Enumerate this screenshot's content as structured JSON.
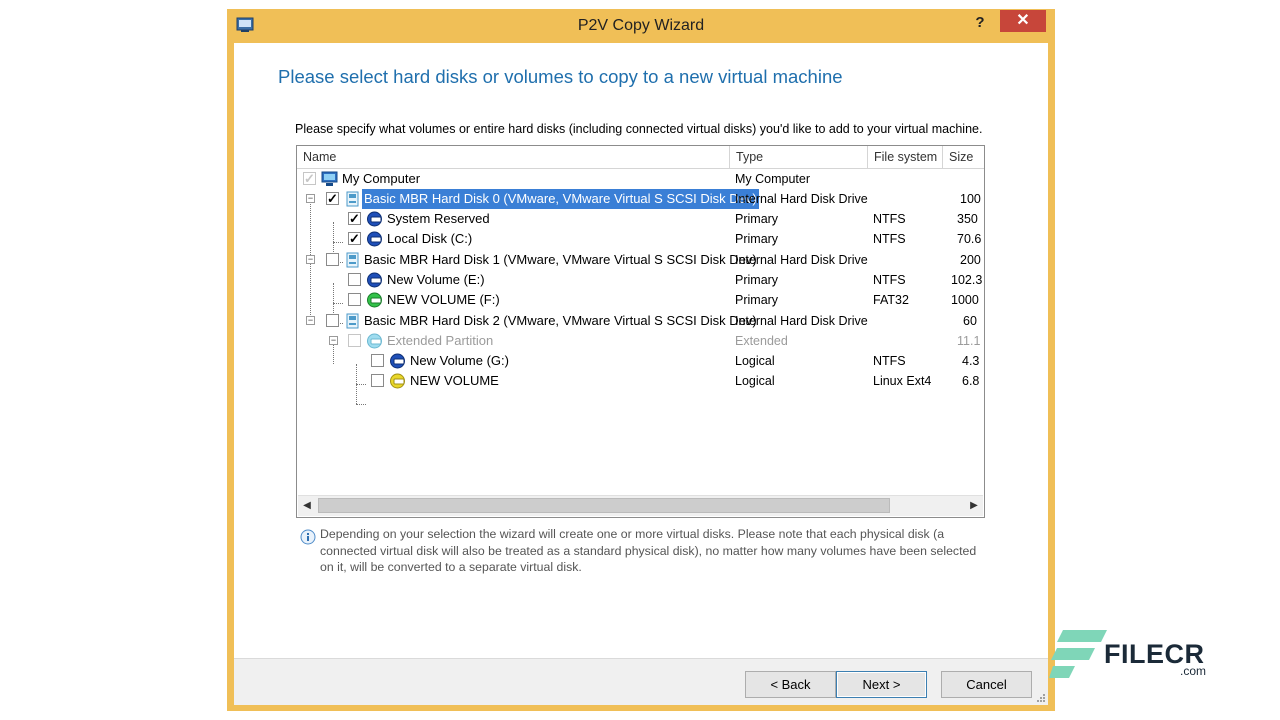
{
  "window": {
    "title": "P2V Copy Wizard",
    "help_label": "?",
    "close_label": "✕",
    "frame_color": "#f0bf57"
  },
  "page": {
    "heading": "Please select hard disks or volumes to copy to a new virtual machine",
    "instructions": "Please specify what volumes or entire hard disks (including connected virtual disks) you'd like to add to your virtual machine."
  },
  "list": {
    "columns": [
      "Name",
      "Type",
      "File system",
      "Size"
    ],
    "rows": [
      {
        "name": "My Computer",
        "type": "My Computer",
        "fs": "",
        "size": "",
        "checked": true,
        "disabled_check": true,
        "icon": "computer-icon"
      },
      {
        "name": "Basic MBR Hard Disk 0 (VMware, VMware Virtual S SCSI Disk Dev)",
        "type": "Internal Hard Disk Drive",
        "fs": "",
        "size": "100",
        "checked": true,
        "selected": true,
        "icon": "hard-disk-icon"
      },
      {
        "name": "System Reserved",
        "type": "Primary",
        "fs": "NTFS",
        "size": "350",
        "checked": true,
        "icon": "ntfs-volume-icon"
      },
      {
        "name": "Local Disk (C:)",
        "type": "Primary",
        "fs": "NTFS",
        "size": "70.6",
        "checked": true,
        "icon": "ntfs-volume-icon"
      },
      {
        "name": "Basic MBR Hard Disk 1 (VMware, VMware Virtual S SCSI Disk Dev)",
        "type": "Internal Hard Disk Drive",
        "fs": "",
        "size": "200",
        "checked": false,
        "icon": "hard-disk-icon"
      },
      {
        "name": "New Volume (E:)",
        "type": "Primary",
        "fs": "NTFS",
        "size": "102.3",
        "checked": false,
        "icon": "ntfs-volume-icon"
      },
      {
        "name": "NEW VOLUME (F:)",
        "type": "Primary",
        "fs": "FAT32",
        "size": "1000",
        "checked": false,
        "icon": "fat-volume-icon"
      },
      {
        "name": "Basic MBR Hard Disk 2 (VMware, VMware Virtual S SCSI Disk Dev)",
        "type": "Internal Hard Disk Drive",
        "fs": "",
        "size": "60",
        "checked": false,
        "icon": "hard-disk-icon"
      },
      {
        "name": "Extended Partition",
        "type": "Extended",
        "fs": "",
        "size": "11.1",
        "checked": false,
        "disabled": true,
        "icon": "extended-partition-icon"
      },
      {
        "name": "New Volume (G:)",
        "type": "Logical",
        "fs": "NTFS",
        "size": "4.3",
        "checked": false,
        "icon": "ntfs-volume-icon"
      },
      {
        "name": "NEW VOLUME",
        "type": "Logical",
        "fs": "Linux Ext4",
        "size": "6.8",
        "checked": false,
        "icon": "linux-volume-icon"
      }
    ]
  },
  "info": {
    "text": "Depending on your selection the wizard will create one or more virtual disks. Please note that each physical disk (a connected virtual disk will also be treated as a standard physical disk), no matter how many volumes have been selected on it, will be converted to a separate virtual disk."
  },
  "buttons": {
    "back": "< Back",
    "next": "Next >",
    "cancel": "Cancel"
  },
  "watermark": {
    "brand": "FILECR",
    "sub": ".com"
  }
}
